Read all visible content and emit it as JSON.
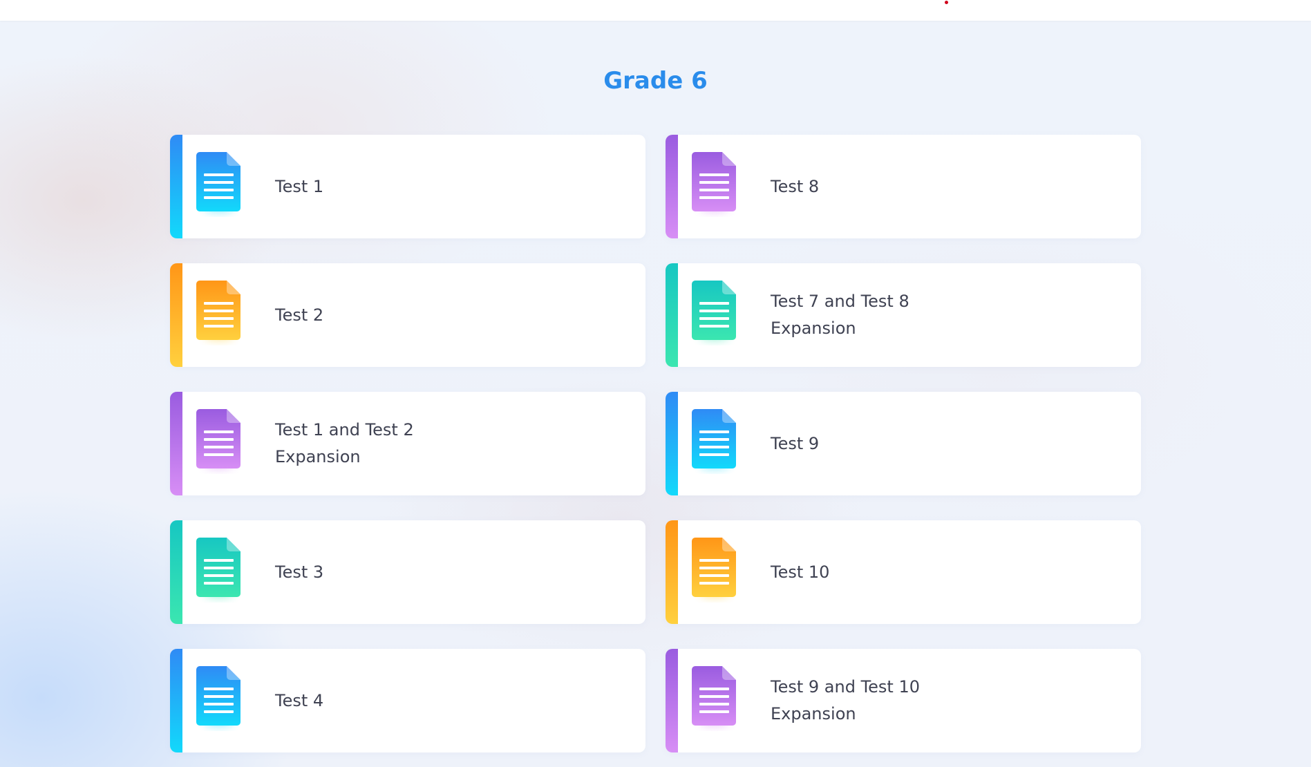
{
  "page": {
    "title": "Grade 6"
  },
  "palettes": {
    "blue": {
      "top": "#2f8bf5",
      "bottom": "#12d9fb"
    },
    "purple": {
      "top": "#9a5ce0",
      "bottom": "#d78ef5"
    },
    "orange": {
      "top": "#ff9617",
      "bottom": "#ffd03e"
    },
    "teal": {
      "top": "#17c7c2",
      "bottom": "#3be6b0"
    }
  },
  "cards": [
    {
      "label": "Test 1",
      "color": "blue",
      "icon": "document-icon"
    },
    {
      "label": "Test 8",
      "color": "purple",
      "icon": "document-icon"
    },
    {
      "label": "Test 2",
      "color": "orange",
      "icon": "document-icon"
    },
    {
      "label": "Test 7 and Test 8 Expansion",
      "color": "teal",
      "icon": "document-icon"
    },
    {
      "label": "Test 1 and Test 2 Expansion",
      "color": "purple",
      "icon": "document-icon"
    },
    {
      "label": "Test 9",
      "color": "blue",
      "icon": "document-icon"
    },
    {
      "label": "Test 3",
      "color": "teal",
      "icon": "document-icon"
    },
    {
      "label": "Test 10",
      "color": "orange",
      "icon": "document-icon"
    },
    {
      "label": "Test 4",
      "color": "blue",
      "icon": "document-icon"
    },
    {
      "label": "Test 9 and Test 10 Expansion",
      "color": "purple",
      "icon": "document-icon"
    }
  ]
}
